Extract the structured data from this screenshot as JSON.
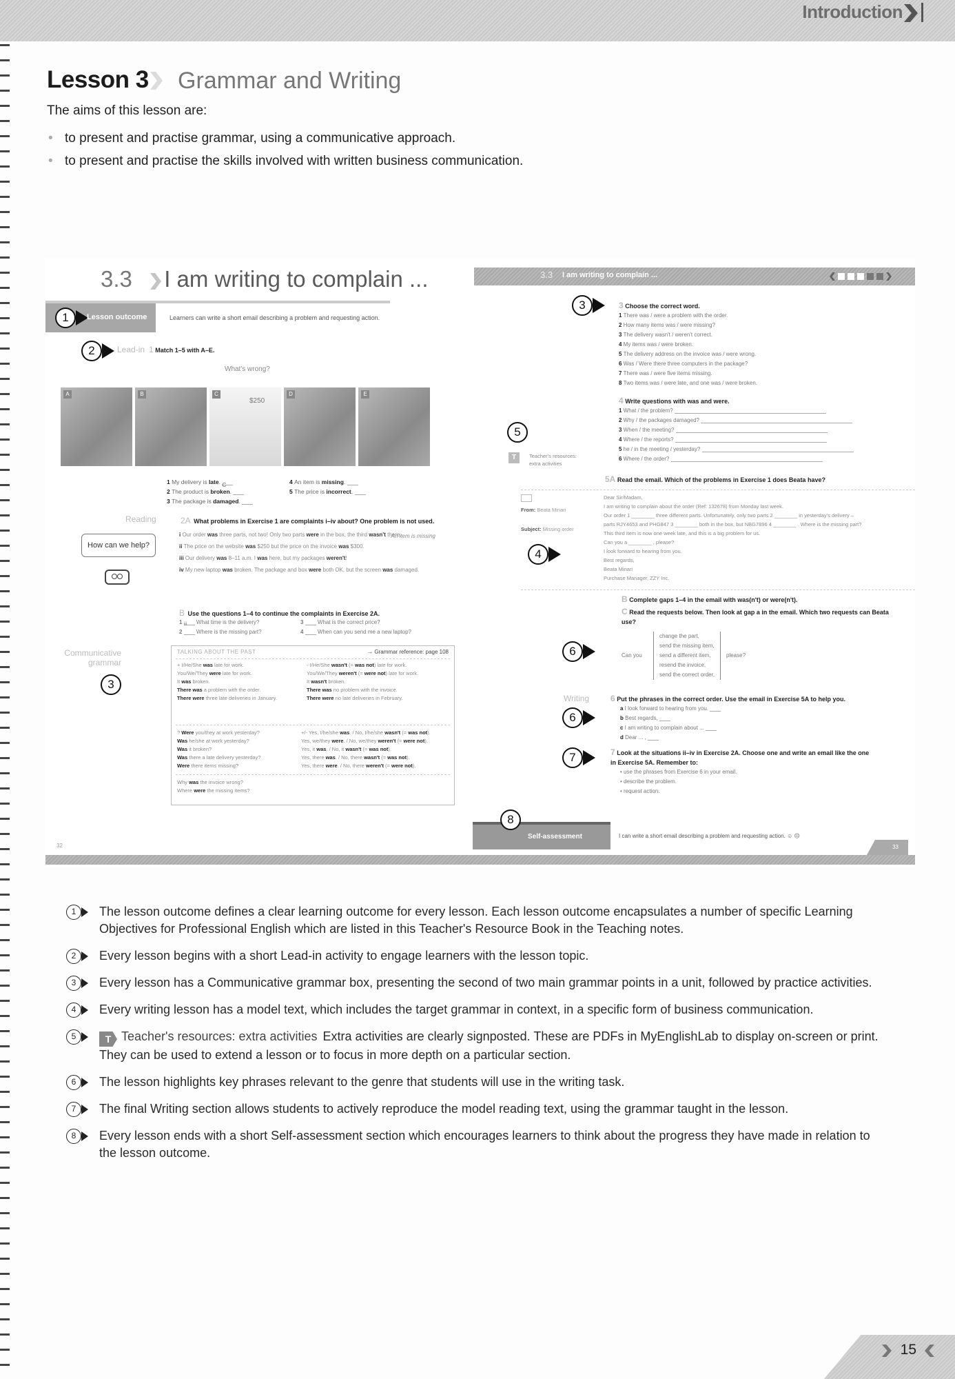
{
  "header": {
    "section": "Introduction"
  },
  "lesson": {
    "title": "Lesson 3",
    "subtitle": "Grammar and Writing",
    "aims_intro": "The aims of this lesson are:",
    "aims": [
      "to present and practise grammar, using a communicative approach.",
      "to present and practise the skills involved with written business communication."
    ]
  },
  "spread": {
    "left": {
      "unit_number": "3.3",
      "unit_title": "I am writing to complain ...",
      "outcome_label": "Lesson outcome",
      "outcome_text": "Learners can write a short email describing a problem and requesting action.",
      "leadin_label": "Lead-in",
      "ex1_num": "1",
      "ex1_title": "Match 1–5 with A–E.",
      "whats_wrong": "What's wrong?",
      "photos": [
        {
          "tag": "A",
          "extra": ""
        },
        {
          "tag": "B",
          "extra": ""
        },
        {
          "tag": "C",
          "extra": "$250"
        },
        {
          "tag": "D",
          "extra": ""
        },
        {
          "tag": "E",
          "extra": ""
        }
      ],
      "match_items": [
        {
          "n": "1",
          "pre": "My delivery is ",
          "bold": "late",
          "ans": "C"
        },
        {
          "n": "4",
          "pre": "An item is ",
          "bold": "missing",
          "ans": ""
        },
        {
          "n": "2",
          "pre": "The product is ",
          "bold": "broken",
          "ans": ""
        },
        {
          "n": "5",
          "pre": "The price is ",
          "bold": "incorrect",
          "ans": ""
        },
        {
          "n": "3",
          "pre": "The package is ",
          "bold": "damaged",
          "ans": ""
        }
      ],
      "reading_label": "Reading",
      "ex2a_num": "2A",
      "ex2a_title": "What problems in Exercise 1 are complaints i–iv about? One problem is not used.",
      "help_bubble": "How can we help?",
      "complaints": [
        {
          "n": "i",
          "text": "Our order was three parts, not two! Only two parts were in the box, the third wasn't there.",
          "answer": "An item is missing"
        },
        {
          "n": "ii",
          "text": "The price on the website was $250 but the price on the invoice was $300.",
          "answer": ""
        },
        {
          "n": "iii",
          "text": "Our delivery was 8–11 a.m. I was here, but my packages weren't!",
          "answer": ""
        },
        {
          "n": "iv",
          "text": "My new laptop was broken. The package and box were both OK, but the screen was damaged.",
          "answer": ""
        }
      ],
      "ex2b_num": "B",
      "ex2b_title": "Use the questions 1–4 to continue the complaints in Exercise 2A.",
      "ex2b_items": [
        {
          "n": "1",
          "ans": "iii",
          "text": "What time is the delivery?"
        },
        {
          "n": "3",
          "ans": "",
          "text": "What is the correct price?"
        },
        {
          "n": "2",
          "ans": "",
          "text": "Where is the missing part?"
        },
        {
          "n": "4",
          "ans": "",
          "text": "When can you send me a new laptop?"
        }
      ],
      "grammar_label_1": "Communicative",
      "grammar_label_2": "grammar",
      "grammar_box": {
        "title": "TALKING ABOUT THE PAST",
        "ref": "→ Grammar reference: page 108",
        "positive": [
          "+ I/He/She was late for work.",
          "You/We/They were late for work.",
          "It was broken.",
          "There was a problem with the order.",
          "There were three late deliveries in January."
        ],
        "negative": [
          "- I/He/She wasn't (= was not) late for work.",
          "You/We/They weren't (= were not) late for work.",
          "It wasn't broken.",
          "There was no problem with the invoice.",
          "There were no late deliveries in February."
        ],
        "questions": [
          "? Were you/they at work yesterday?",
          "Was he/she at work yesterday?",
          "Was it broken?",
          "Was there a late delivery yesterday?",
          "Were there items missing?"
        ],
        "short_answers": [
          "+/- Yes, I/he/she was. / No, I/he/she wasn't (= was not).",
          "Yes, we/they were. / No, we/they weren't (= were not).",
          "Yes, it was. / No, it wasn't (= was not).",
          "Yes, there was. / No, there wasn't (= was not).",
          "Yes, there were. / No, there weren't (= were not)."
        ],
        "wh_questions": [
          "Why was the invoice wrong?",
          "Where were the missing items?"
        ]
      },
      "page_number": "32"
    },
    "right": {
      "header_number": "3.3",
      "header_title": "I am writing to complain ...",
      "ex3_num": "3",
      "ex3_title": "Choose the correct word.",
      "ex3_items": [
        "There was / were a problem with the order.",
        "How many items was / were missing?",
        "The delivery wasn't / weren't correct.",
        "My items was / were broken.",
        "The delivery address on the invoice was / were wrong.",
        "Was / Were there three computers in the package?",
        "There was / were five items missing.",
        "Two items was / were late, and one was / were broken."
      ],
      "ex4_num": "4",
      "ex4_title": "Write questions with was and were.",
      "ex4_items": [
        "What / the problem?",
        "Why / the packages damaged?",
        "When / the meeting?",
        "Where / the reports?",
        "he / in the meeting / yesterday?",
        "Where / the order?"
      ],
      "teacher_resources_icon": "T",
      "teacher_resources": "Teacher's resources: extra activities",
      "ex5a_num": "5A",
      "ex5a_title": "Read the email. Which of the problems in Exercise 1 does Beata have?",
      "email": {
        "from_label": "From:",
        "from": "Beata Minari",
        "subject_label": "Subject:",
        "subject": "Missing order",
        "lines": [
          "Dear Sir/Madam,",
          "I am writing to complain about the order (Ref: 132678) from Monday last week.",
          "Our order 1 ________ three different parts. Unfortunately, only two parts 2 ________ in yesterday's delivery – parts RJY4653 and PHG847 3 ________ both in the box, but NBG7896 4 ________ . Where is the missing part?",
          "This third item is now one week late, and this is a big problem for us.",
          "Can you a ________ , please?",
          "I look forward to hearing from you.",
          "Best regards,",
          "Beata Minari",
          "Purchase Manager, ZZY Inc."
        ]
      },
      "ex5b_num": "B",
      "ex5b_title": "Complete gaps 1–4 in the email with was(n't) or were(n't).",
      "ex5c_num": "C",
      "ex5c_title": "Read the requests below. Then look at gap a in the email. Which two requests can Beata use?",
      "requests_prefix": "Can you",
      "requests": [
        "change the part,",
        "send the missing item,",
        "send a different item,",
        "resend the invoice,",
        "send the correct order,"
      ],
      "requests_suffix": "please?",
      "writing_label": "Writing",
      "ex6_num": "6",
      "ex6_title": "Put the phrases in the correct order. Use the email in Exercise 5A to help you.",
      "ex6_items": [
        {
          "l": "a",
          "t": "I look forward to hearing from you."
        },
        {
          "l": "b",
          "t": "Best regards,"
        },
        {
          "l": "c",
          "t": "I am writing to complain about ..."
        },
        {
          "l": "d",
          "t": "Dear ... ,"
        }
      ],
      "ex7_num": "7",
      "ex7_title": "Look at the situations ii–iv in Exercise 2A. Choose one and write an email like the one in Exercise 5A. Remember to:",
      "ex7_items": [
        "use the phrases from Exercise 6 in your email.",
        "describe the problem.",
        "request action."
      ],
      "self_assessment_label": "Self-assessment",
      "self_assessment_text": "I can write a short email describing a problem and requesting action.",
      "page_number": "33"
    },
    "callouts": [
      "1",
      "2",
      "3",
      "3",
      "4",
      "5",
      "6",
      "6",
      "7",
      "8"
    ]
  },
  "notes": [
    {
      "n": "1",
      "text": "The lesson outcome defines a clear learning outcome for every lesson. Each lesson outcome encapsulates a number of specific Learning Objectives for Professional English which are listed in this Teacher's Resource Book in the Teaching notes."
    },
    {
      "n": "2",
      "text": "Every lesson begins with a short Lead-in activity to engage learners with the lesson topic."
    },
    {
      "n": "3",
      "text": "Every lesson has a Communicative grammar box, presenting the second of two main grammar points in a unit, followed by practice activities."
    },
    {
      "n": "4",
      "text": "Every writing lesson has a model text, which includes the target grammar in context, in a specific form of business communication."
    },
    {
      "n": "5",
      "badge": "T",
      "label": "Teacher's resources: extra activities",
      "text": "Extra activities are clearly signposted. These are PDFs in MyEnglishLab to display on-screen or print. They can be used to extend a lesson or to focus in more depth on a particular section."
    },
    {
      "n": "6",
      "text": "The lesson highlights key phrases relevant to the genre that students will use in the writing task."
    },
    {
      "n": "7",
      "text": "The final Writing section allows students to actively reproduce the model reading text, using the grammar taught in the lesson."
    },
    {
      "n": "8",
      "text": "Every lesson ends with a short Self-assessment section which encourages learners to think about the progress they have made in relation to the lesson outcome."
    }
  ],
  "footer": {
    "page_number": "15"
  }
}
